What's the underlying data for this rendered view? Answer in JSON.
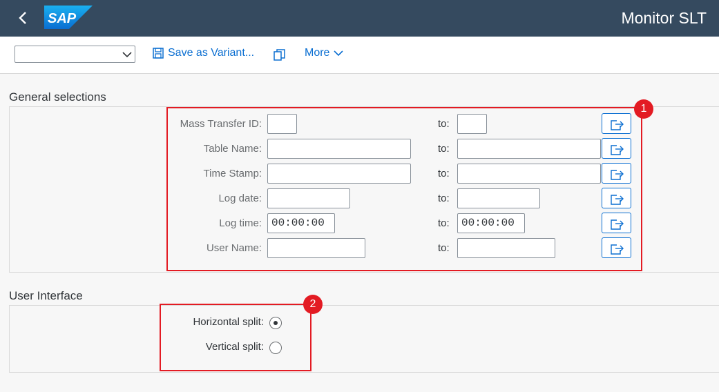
{
  "header": {
    "title": "Monitor SLT",
    "logo_text": "SAP"
  },
  "toolbar": {
    "variant_value": "",
    "save_variant_label": "Save as Variant...",
    "more_label": "More"
  },
  "general": {
    "title": "General selections",
    "rows": [
      {
        "label": "Mass Transfer ID:",
        "from": "",
        "to_label": "to:",
        "to": ""
      },
      {
        "label": "Table Name:",
        "from": "",
        "to_label": "to:",
        "to": ""
      },
      {
        "label": "Time Stamp:",
        "from": "",
        "to_label": "to:",
        "to": ""
      },
      {
        "label": "Log date:",
        "from": "",
        "to_label": "to:",
        "to": ""
      },
      {
        "label": "Log time:",
        "from": "00:00:00",
        "to_label": "to:",
        "to": "00:00:00"
      },
      {
        "label": "User Name:",
        "from": "",
        "to_label": "to:",
        "to": ""
      }
    ]
  },
  "ui": {
    "title": "User Interface",
    "options": [
      {
        "label": "Horizontal split:",
        "selected": true
      },
      {
        "label": "Vertical split:",
        "selected": false
      }
    ]
  },
  "annotations": [
    "1",
    "2"
  ],
  "colors": {
    "shell": "#354a5f",
    "accent": "#0a6ed1",
    "highlight": "#e31b23"
  }
}
